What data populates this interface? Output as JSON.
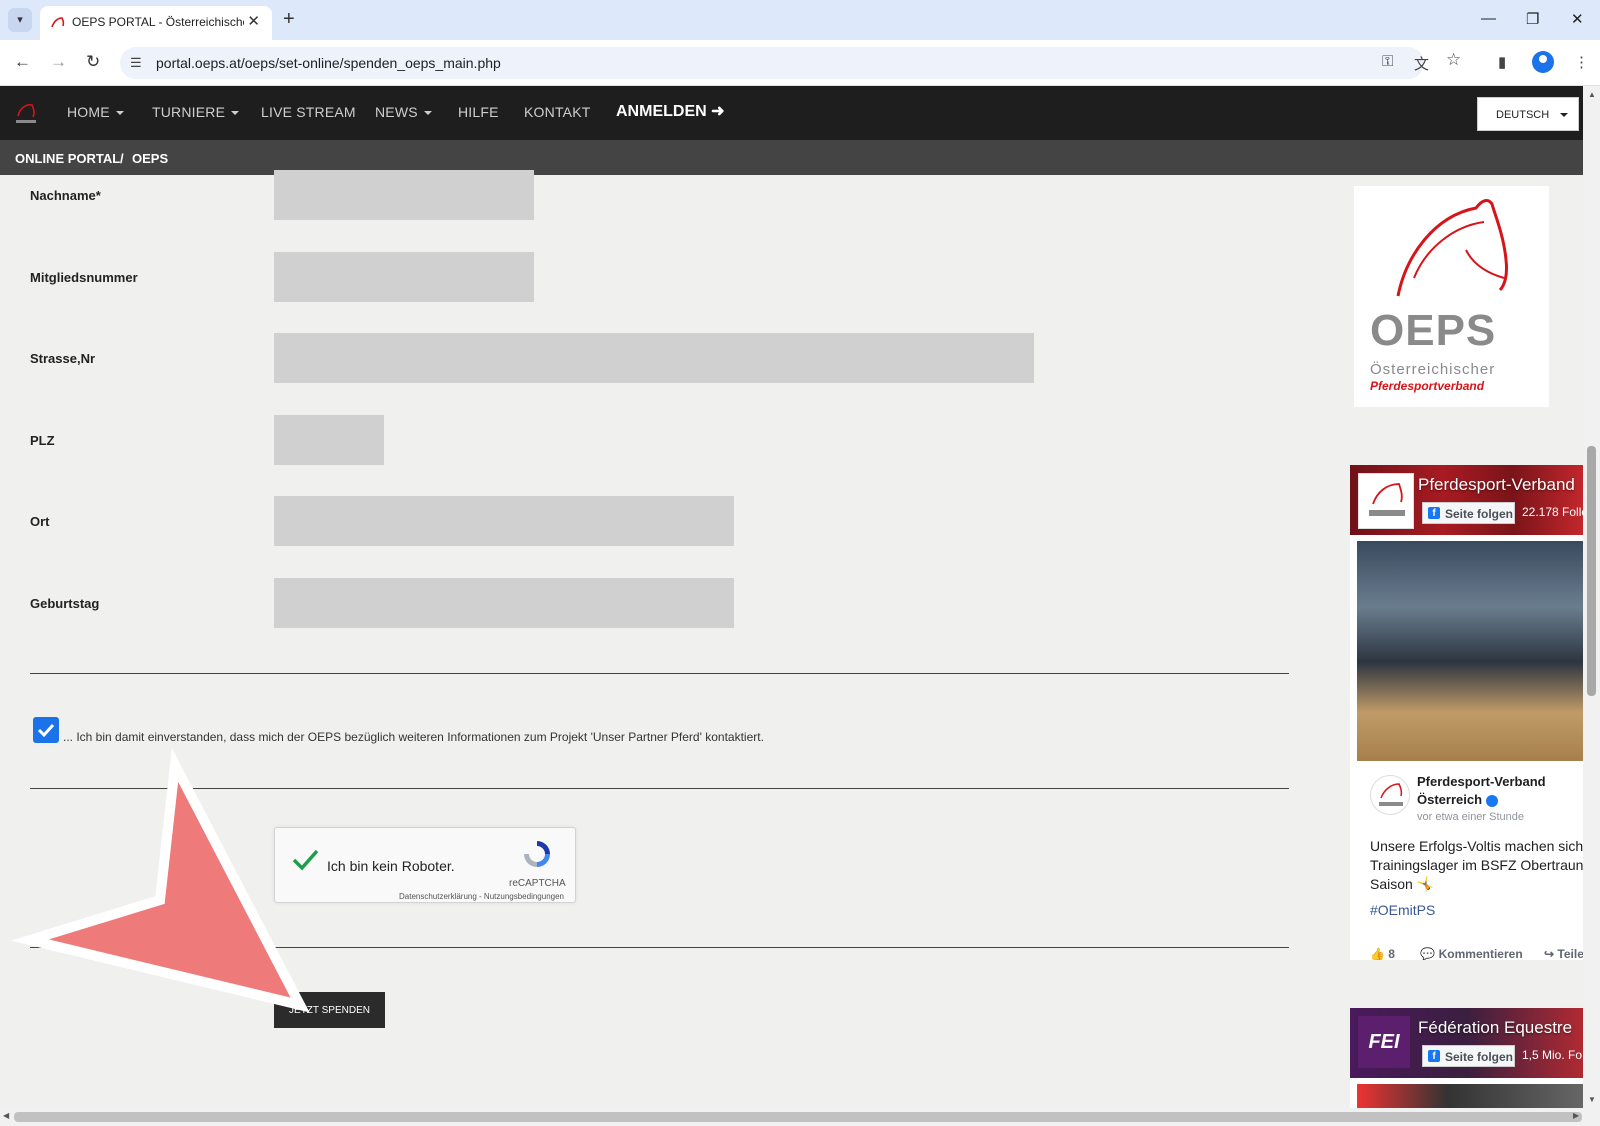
{
  "browser": {
    "tab_title": "OEPS PORTAL - Österreichischer",
    "close_glyph": "✕",
    "new_tab_glyph": "+",
    "url": "portal.oeps.at/oeps/set-online/spenden_oeps_main.php"
  },
  "nav": {
    "items": [
      "HOME",
      "TURNIERE",
      "LIVE STREAM",
      "NEWS",
      "HILFE",
      "KONTAKT"
    ],
    "login": "ANMELDEN",
    "language": "DEUTSCH"
  },
  "breadcrumb": [
    "ONLINE PORTAL",
    "/",
    "OEPS"
  ],
  "form": {
    "fields": [
      {
        "label": "Nachname*",
        "value": ""
      },
      {
        "label": "Mitgliedsnummer",
        "value": ""
      },
      {
        "label": "Strasse,Nr",
        "value": ""
      },
      {
        "label": "PLZ",
        "value": ""
      },
      {
        "label": "Ort",
        "value": ""
      },
      {
        "label": "Geburtstag",
        "value": ""
      }
    ],
    "consent_text": "... Ich bin damit einverstanden, dass mich der OEPS bezüglich weiteren Informationen zum Projekt 'Unser Partner Pferd' kontaktiert.",
    "consent_checked": true,
    "recaptcha": {
      "label": "Ich bin kein Roboter.",
      "brand": "reCAPTCHA",
      "links": "Datenschutzerklärung - Nutzungsbedingungen"
    },
    "submit_label": "JETZT SPENDEN"
  },
  "sidebar": {
    "logo_text": "OEPS",
    "logo_sub1": "Österreichischer",
    "logo_sub2": "Pferdesportverband",
    "fb1": {
      "page_name": "Pferdesport-Verband",
      "follow": "Seite folgen",
      "followers": "22.178 Follo",
      "post_author_1": "Pferdesport-Verband",
      "post_author_2": "Österreich",
      "post_time": "vor etwa einer Stunde",
      "post_lines": [
        "Unsere Erfolgs-Voltis machen sich",
        "Trainingslager im BSFZ Obertraun",
        "Saison 🤸"
      ],
      "hashtag": "#OEmitPS",
      "likes": "8",
      "comment": "Kommentieren",
      "share": "Teile"
    },
    "fb2": {
      "page_name": "Fédération Equestre",
      "follow": "Seite folgen",
      "followers": "1,5 Mio. Fo",
      "avatar_text": "FEI"
    }
  },
  "colors": {
    "navbar": "#1e1e1e",
    "breadcrumb": "#444444",
    "page_bg": "#f0f1ef",
    "input_bg": "#d0d0d0",
    "oeps_red": "#d7141a",
    "oeps_grey": "#8a8a8a",
    "checkbox": "#1a73e8",
    "annotation_arrow": "#ee7a7a"
  }
}
